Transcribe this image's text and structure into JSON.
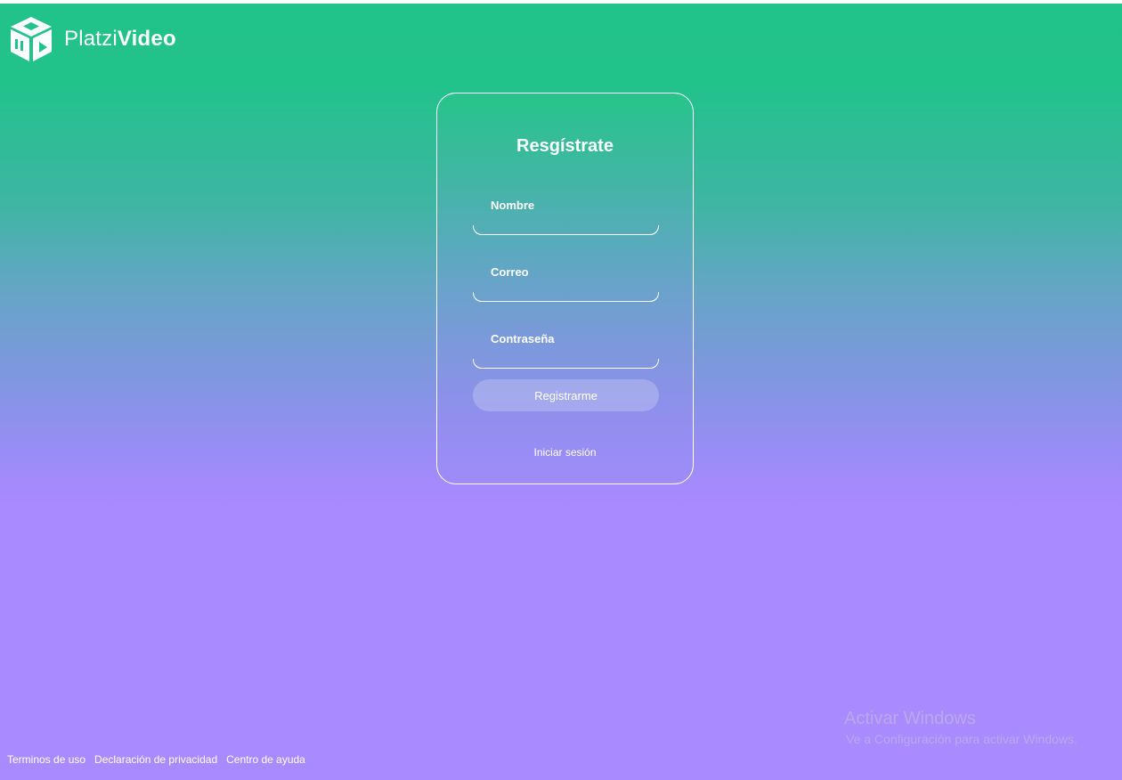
{
  "header": {
    "brand_light": "Platzi",
    "brand_bold": "Video",
    "logo_icon": "platzi-video-cube-icon"
  },
  "register": {
    "title": "Resgístrate",
    "fields": {
      "name_label": "Nombre",
      "email_label": "Correo",
      "password_label": "Contraseña"
    },
    "submit_label": "Registrarme",
    "login_link": "Iniciar sesión"
  },
  "footer": {
    "links": [
      "Terminos de uso",
      "Declaración de privacidad",
      "Centro de ayuda"
    ]
  },
  "watermark": {
    "title": "Activar Windows",
    "subtitle": "Ve a Configuración para activar Windows."
  },
  "colors": {
    "gradient_top": "#21c38a",
    "gradient_bottom": "#a98aff",
    "text": "#ffffff"
  }
}
